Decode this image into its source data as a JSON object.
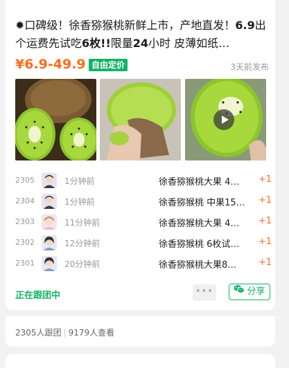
{
  "post": {
    "title_prefix": "✹口碑级！徐香猕猴桃新鲜上市，产地直发！",
    "title_bold1": "6.9",
    "title_mid": "出个运费先试吃",
    "title_bold2": "6枚!!",
    "title_mid2": "限量",
    "title_bold3": "24",
    "title_suffix": "小时 皮薄如纸…",
    "price": "¥6.9-49.9",
    "price_badge": "自由定价",
    "posted": "3天前发布"
  },
  "gallery": {
    "icons": [
      "kiwi-halves-photo",
      "kiwi-peel-photo",
      "kiwi-bite-video"
    ],
    "video_icon": "play-icon"
  },
  "orders": [
    {
      "no": "2305",
      "time": "1分钟前",
      "product": "徐香猕猴桃大果 4…",
      "qty": "+1"
    },
    {
      "no": "2304",
      "time": "1分钟前",
      "product": "徐香猕猴桃 中果15…",
      "qty": "+1"
    },
    {
      "no": "2303",
      "time": "11分钟前",
      "product": "徐香猕猴桃大果 4…",
      "qty": "+1"
    },
    {
      "no": "2302",
      "time": "12分钟前",
      "product": "徐香猕猴桃 6枚试…",
      "qty": "+1"
    },
    {
      "no": "2301",
      "time": "20分钟前",
      "product": "徐香猕猴桃大果8…",
      "qty": "+1"
    }
  ],
  "actions": {
    "follow_label": "正在跟团中",
    "more_label": "•••",
    "share_label": "分享"
  },
  "stats": {
    "joined": "2305人跟团",
    "views": "9179人查看"
  },
  "colors": {
    "accent_green": "#14b266",
    "price_orange": "#ff6a1f"
  }
}
